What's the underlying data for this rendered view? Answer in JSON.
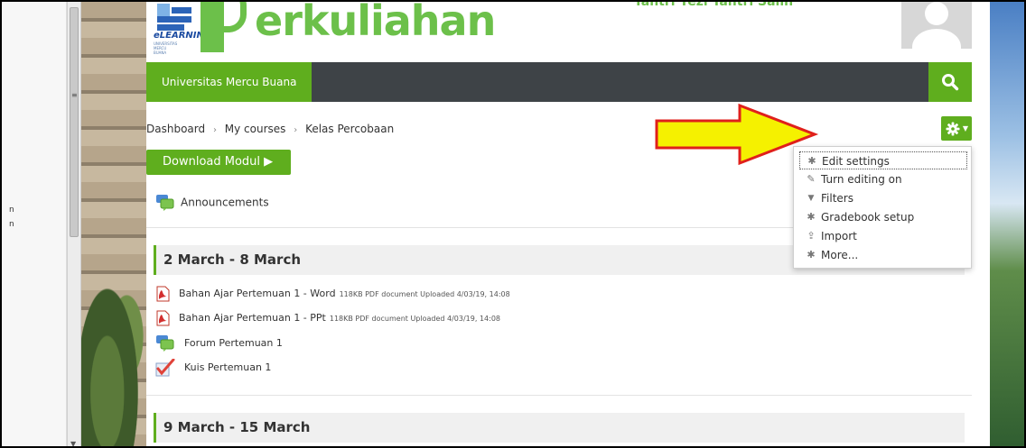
{
  "left_panel": {
    "marks": [
      "n",
      "n"
    ],
    "scroll_glyph": "≡"
  },
  "header": {
    "logo_small": "eLEARNING",
    "logo_sub": "UNIVERSITAS MERCU BUANA",
    "logo_word": "erkuliahan",
    "user_name": "Tantri Yezi Tantri Salih"
  },
  "navbar": {
    "brand": "Universitas Mercu Buana",
    "search_icon": "search-icon"
  },
  "breadcrumb": {
    "items": [
      "Dashboard",
      "My courses",
      "Kelas Percobaan"
    ],
    "separator": "›"
  },
  "settings_menu": {
    "items": [
      {
        "label": "Edit settings",
        "icon": "gear-icon",
        "glyph": "✱"
      },
      {
        "label": "Turn editing on",
        "icon": "pencil-icon",
        "glyph": "✎"
      },
      {
        "label": "Filters",
        "icon": "filter-icon",
        "glyph": "▼"
      },
      {
        "label": "Gradebook setup",
        "icon": "gear-icon",
        "glyph": "✱"
      },
      {
        "label": "Import",
        "icon": "upload-icon",
        "glyph": "⇪"
      },
      {
        "label": "More...",
        "icon": "gear-icon",
        "glyph": "✱"
      }
    ]
  },
  "download_button": {
    "label": "Download Modul ▶"
  },
  "announcements": {
    "label": "Announcements"
  },
  "sections": [
    {
      "title": "2 March - 8 March",
      "activities": [
        {
          "label": "Bahan Ajar Pertemuan 1 - Word",
          "meta": "118KB PDF document Uploaded 4/03/19, 14:08",
          "icon": "pdf-icon"
        },
        {
          "label": "Bahan Ajar Pertemuan 1 - PPt",
          "meta": "118KB PDF document Uploaded 4/03/19, 14:08",
          "icon": "pdf-icon"
        },
        {
          "label": "Forum Pertemuan 1",
          "meta": "",
          "icon": "forum-icon"
        },
        {
          "label": "Kuis Pertemuan 1",
          "meta": "",
          "icon": "quiz-icon"
        }
      ]
    },
    {
      "title": "9 March - 15 March",
      "activities": []
    }
  ],
  "colors": {
    "accent": "#5fae1e",
    "navbar": "#3e4347",
    "arrow_fill": "#f5f100",
    "arrow_stroke": "#e0201b"
  }
}
